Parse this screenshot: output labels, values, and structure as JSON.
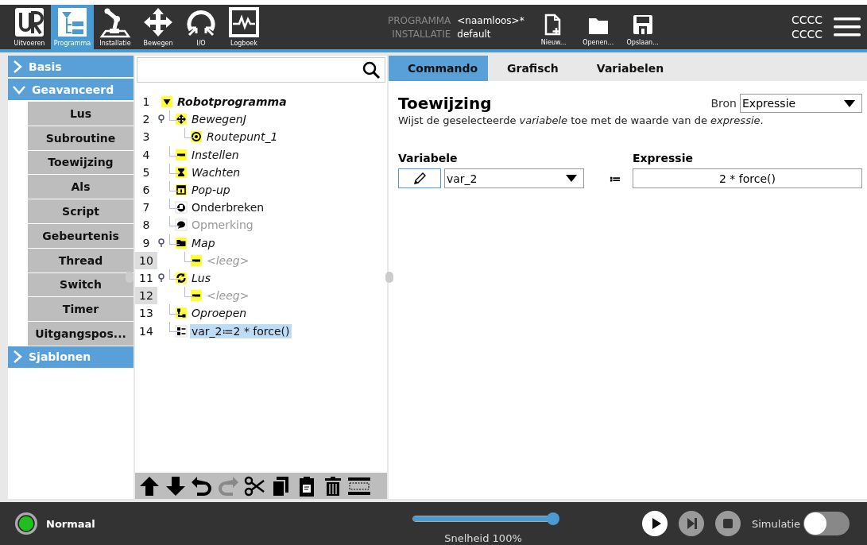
{
  "header": {
    "tabs": [
      {
        "label": "Uitvoeren",
        "kind": "logo",
        "selected": false
      },
      {
        "label": "Programma",
        "kind": "program",
        "selected": true
      },
      {
        "label": "Installatie",
        "kind": "robot",
        "selected": false
      },
      {
        "label": "Bewegen",
        "kind": "move",
        "selected": false
      },
      {
        "label": "I/O",
        "kind": "io",
        "selected": false
      },
      {
        "label": "Logboek",
        "kind": "log",
        "selected": false
      }
    ],
    "program_label": "PROGRAMMA",
    "program_value": "<naamloos>*",
    "installation_label": "INSTALLATIE",
    "installation_value": "default",
    "file_buttons": [
      {
        "label": "Nieuw...",
        "kind": "new"
      },
      {
        "label": "Openen...",
        "kind": "open"
      },
      {
        "label": "Opslaan...",
        "kind": "save"
      }
    ],
    "status_lines": [
      "CCCC",
      "CCCC"
    ]
  },
  "sidebar": {
    "sections": [
      {
        "label": "Basis",
        "expanded": false
      },
      {
        "label": "Geavanceerd",
        "expanded": true,
        "items": [
          "Lus",
          "Subroutine",
          "Toewijzing",
          "Als",
          "Script",
          "Gebeurtenis",
          "Thread",
          "Switch",
          "Timer",
          "Uitgangspos..."
        ]
      },
      {
        "label": "Sjablonen",
        "expanded": false
      }
    ]
  },
  "tree": {
    "rows": [
      {
        "number": "1",
        "label": "Robotprogramma",
        "kind": "root",
        "incomplete": true,
        "disabled": false,
        "selected": false,
        "expanded": true,
        "children": [
          {
            "number": "2",
            "label": "BewegenJ",
            "kind": "move",
            "incomplete": true,
            "disabled": false,
            "selected": false,
            "expanded": true,
            "children": [
              {
                "number": "3",
                "label": "Routepunt_1",
                "kind": "waypoint",
                "incomplete": true,
                "disabled": false,
                "selected": false
              }
            ]
          },
          {
            "number": "4",
            "label": "Instellen",
            "kind": "set",
            "incomplete": true,
            "disabled": false,
            "selected": false
          },
          {
            "number": "5",
            "label": "Wachten",
            "kind": "wait",
            "incomplete": true,
            "disabled": false,
            "selected": false
          },
          {
            "number": "6",
            "label": "Pop-up",
            "kind": "popup",
            "incomplete": true,
            "disabled": false,
            "selected": false
          },
          {
            "number": "7",
            "label": "Onderbreken",
            "kind": "halt",
            "incomplete": false,
            "disabled": false,
            "selected": false
          },
          {
            "number": "8",
            "label": "Opmerking",
            "kind": "comment",
            "incomplete": false,
            "disabled": true,
            "selected": false
          },
          {
            "number": "9",
            "label": "Map",
            "kind": "folder",
            "incomplete": true,
            "disabled": false,
            "selected": false,
            "expanded": true,
            "children": [
              {
                "number": "10",
                "label": "<leeg>",
                "kind": "empty",
                "incomplete": true,
                "disabled": true,
                "selected": false
              }
            ]
          },
          {
            "number": "11",
            "label": "Lus",
            "kind": "loop",
            "incomplete": true,
            "disabled": false,
            "selected": false,
            "expanded": true,
            "children": [
              {
                "number": "12",
                "label": "<leeg>",
                "kind": "empty",
                "incomplete": true,
                "disabled": true,
                "selected": false
              }
            ]
          },
          {
            "number": "13",
            "label": "Oproepen",
            "kind": "call",
            "incomplete": true,
            "disabled": false,
            "selected": false
          },
          {
            "number": "14",
            "label": "var_2≔2 * force()",
            "kind": "assign",
            "incomplete": false,
            "disabled": false,
            "selected": true
          }
        ]
      }
    ],
    "toolbar": [
      {
        "kind": "up",
        "disabled": false
      },
      {
        "kind": "down",
        "disabled": false
      },
      {
        "kind": "undo",
        "disabled": false
      },
      {
        "kind": "redo",
        "disabled": true
      },
      {
        "kind": "cut",
        "disabled": false
      },
      {
        "kind": "copy",
        "disabled": false
      },
      {
        "kind": "paste",
        "disabled": false
      },
      {
        "kind": "delete",
        "disabled": false
      },
      {
        "kind": "suppress",
        "disabled": false
      }
    ]
  },
  "command": {
    "tabs": [
      {
        "label": "Commando",
        "selected": true
      },
      {
        "label": "Grafisch",
        "selected": false
      },
      {
        "label": "Variabelen",
        "selected": false
      }
    ],
    "title": "Toewijzing",
    "source_label": "Bron",
    "source_value": "Expressie",
    "description": "Wijst de geselecteerde *variabele* toe met de waarde van de *expressie*.",
    "variable_label": "Variabele",
    "variable_value": "var_2",
    "operator": "≔",
    "expression_label": "Expressie",
    "expression_value": "2 * force()"
  },
  "footer": {
    "status": "Normaal",
    "speed": {
      "level": 1.0
    },
    "speed_label": "Snelheid 100%",
    "simulation_label": "Simulatie",
    "simulation_on": false,
    "controls": [
      {
        "kind": "play",
        "disabled": false
      },
      {
        "kind": "step",
        "disabled": true
      },
      {
        "kind": "stop",
        "disabled": true
      }
    ]
  }
}
